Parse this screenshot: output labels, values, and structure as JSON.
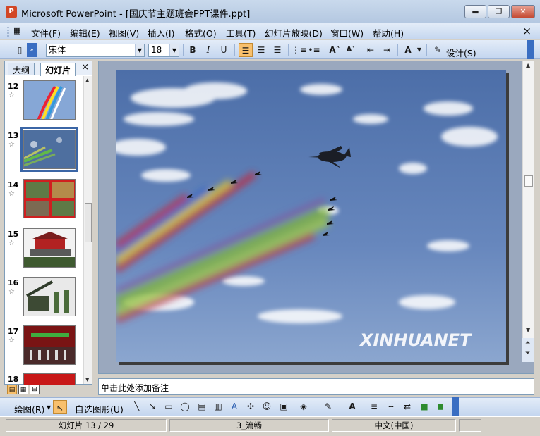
{
  "window": {
    "title": "Microsoft PowerPoint - [国庆节主题班会PPT课件.ppt]",
    "app_icon": "P",
    "minimize_glyph": "▬",
    "restore_glyph": "❐",
    "close_glyph": "✕"
  },
  "menu": {
    "items": [
      "文件(F)",
      "编辑(E)",
      "视图(V)",
      "插入(I)",
      "格式(O)",
      "工具(T)",
      "幻灯片放映(D)",
      "窗口(W)",
      "帮助(H)"
    ],
    "close_glyph": "×"
  },
  "toolbar": {
    "font_name": "宋体",
    "font_size": "18",
    "bold": "B",
    "italic": "I",
    "underline": "U",
    "grow_font": "A˄",
    "shrink_font": "A˅",
    "font_color": "A",
    "design_label": "设计(S)"
  },
  "left_pane": {
    "tab_outline": "大纲",
    "tab_slides": "幻灯片",
    "close_glyph": "×",
    "thumbnails": [
      {
        "num": "12",
        "star": "☆",
        "icon": "air-show-thumbnail"
      },
      {
        "num": "13",
        "star": "☆",
        "icon": "sky-jets-thumbnail",
        "selected": true
      },
      {
        "num": "14",
        "star": "☆",
        "icon": "red-collage-thumbnail"
      },
      {
        "num": "15",
        "star": "☆",
        "icon": "gate-tower-thumbnail"
      },
      {
        "num": "16",
        "star": "☆",
        "icon": "artillery-thumbnail"
      },
      {
        "num": "17",
        "star": "☆",
        "icon": "ceremony-thumbnail"
      },
      {
        "num": "18",
        "star": "☆",
        "icon": "red-thumbnail"
      }
    ]
  },
  "slide": {
    "watermark": "XINHUANET"
  },
  "notes": {
    "placeholder": "单击此处添加备注"
  },
  "drawing_toolbar": {
    "draw_label": "绘图(R)",
    "autoshape_label": "自选图形(U)"
  },
  "status": {
    "slide_info": "幻灯片 13 / 29",
    "design_name": "3_流畅",
    "language": "中文(中国)"
  },
  "colors": {
    "sky": "#5d7bb0",
    "selection": "#3b66a6",
    "toolbar_active": "#f8c06d"
  }
}
